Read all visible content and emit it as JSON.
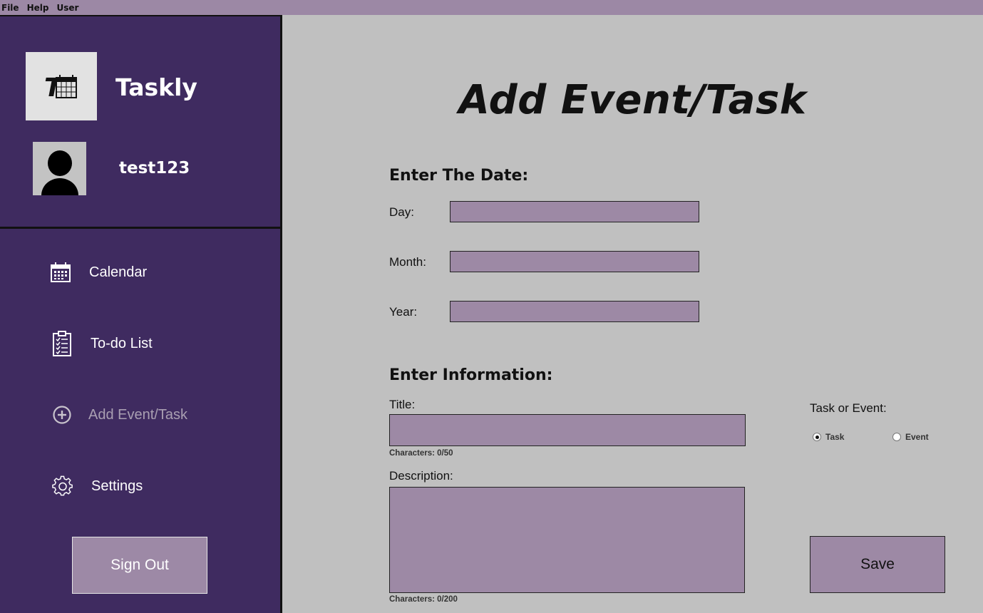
{
  "menu": [
    "File",
    "Help",
    "User"
  ],
  "sidebar": {
    "app_name": "Taskly",
    "username": "test123",
    "items": [
      {
        "label": "Calendar",
        "icon": "calendar-icon"
      },
      {
        "label": "To-do List",
        "icon": "clipboard-checklist-icon"
      },
      {
        "label": "Add Event/Task",
        "icon": "plus-circle-icon",
        "active": true
      },
      {
        "label": "Settings",
        "icon": "gear-icon"
      }
    ],
    "sign_out": "Sign Out"
  },
  "main": {
    "title": "Add Event/Task",
    "date_section": "Enter The Date:",
    "day_label": "Day:",
    "month_label": "Month:",
    "year_label": "Year:",
    "day_value": "",
    "month_value": "",
    "year_value": "",
    "info_section": "Enter Information:",
    "title_label": "Title:",
    "title_value": "",
    "title_counter": "Characters: 0/50",
    "description_label": "Description:",
    "description_value": "",
    "description_counter": "Characters: 0/200",
    "type_label": "Task or Event:",
    "options": [
      {
        "label": "Task",
        "selected": true
      },
      {
        "label": "Event",
        "selected": false
      }
    ],
    "save": "Save"
  },
  "colors": {
    "sidebar": "#3f2b60",
    "accent": "#9d89a5",
    "background": "#c0c0c0",
    "menubar": "#9c88a5"
  }
}
